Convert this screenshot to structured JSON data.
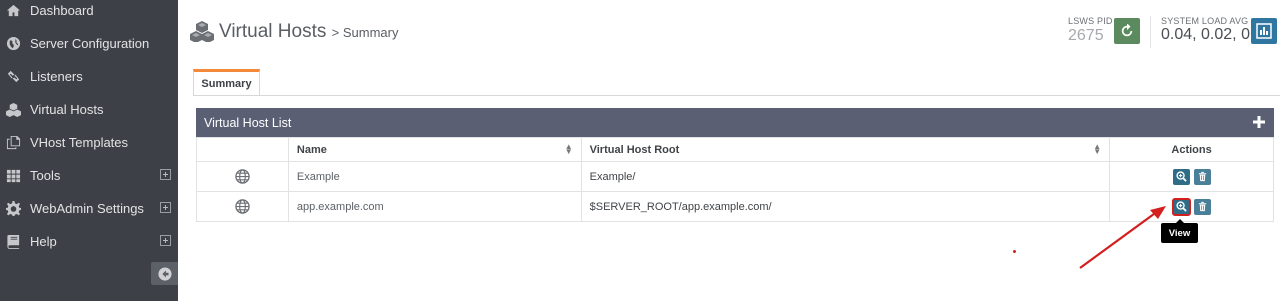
{
  "sidebar": {
    "items": [
      {
        "label": "Dashboard",
        "icon": "home-icon",
        "expandable": false
      },
      {
        "label": "Server Configuration",
        "icon": "globe-icon",
        "expandable": false
      },
      {
        "label": "Listeners",
        "icon": "link-icon",
        "expandable": false
      },
      {
        "label": "Virtual Hosts",
        "icon": "cubes-icon",
        "expandable": false
      },
      {
        "label": "VHost Templates",
        "icon": "copy-icon",
        "expandable": false
      },
      {
        "label": "Tools",
        "icon": "grid-icon",
        "expandable": true
      },
      {
        "label": "WebAdmin Settings",
        "icon": "gear-icon",
        "expandable": true
      },
      {
        "label": "Help",
        "icon": "book-icon",
        "expandable": true
      }
    ]
  },
  "header": {
    "title": "Virtual Hosts",
    "subtitle": "> Summary",
    "pid_label": "LSWS PID",
    "pid_value": "2675",
    "load_label": "SYSTEM LOAD AVG",
    "load_value": "0.04, 0.02, 0"
  },
  "tabs": [
    {
      "label": "Summary",
      "active": true
    }
  ],
  "panel": {
    "title": "Virtual Host List",
    "columns": [
      "",
      "Name",
      "Virtual Host Root",
      "Actions"
    ],
    "rows": [
      {
        "name": "Example",
        "root": "Example/"
      },
      {
        "name": "app.example.com",
        "root": "$SERVER_ROOT/app.example.com/"
      }
    ]
  },
  "tooltip": {
    "text": "View"
  },
  "colors": {
    "sidebar_bg": "#3d4046",
    "panel_header": "#5a5f73",
    "accent_tab": "#f4893a",
    "refresh_button": "#5a8a5e",
    "chart_button": "#2f77a0",
    "action_button": "#2e6c87",
    "annotation": "#d41f1f"
  }
}
